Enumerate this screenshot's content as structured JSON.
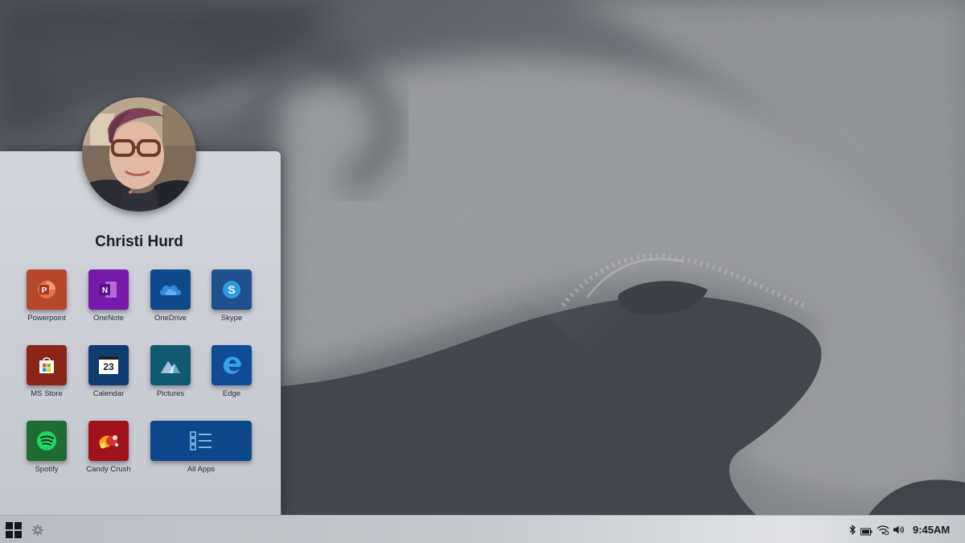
{
  "user": {
    "name": "Christi Hurd"
  },
  "tiles": [
    {
      "label": "Powerpoint",
      "icon": "powerpoint-icon",
      "color": "#b7472a"
    },
    {
      "label": "OneNote",
      "icon": "onenote-icon",
      "color": "#7719aa"
    },
    {
      "label": "OneDrive",
      "icon": "onedrive-icon",
      "color": "#0e4a8a"
    },
    {
      "label": "Skype",
      "icon": "skype-icon",
      "color": "#1f4f8d"
    },
    {
      "label": "MS Store",
      "icon": "store-icon",
      "color": "#8a2518"
    },
    {
      "label": "Calendar",
      "icon": "calendar-icon",
      "color": "#0f3c70",
      "badge": "23"
    },
    {
      "label": "Pictures",
      "icon": "pictures-icon",
      "color": "#125a74"
    },
    {
      "label": "Edge",
      "icon": "edge-icon",
      "color": "#0f4c95"
    },
    {
      "label": "Spotify",
      "icon": "spotify-icon",
      "color": "#1e6b34"
    },
    {
      "label": "Candy Crush",
      "icon": "candy-crush-icon",
      "color": "#a0131a"
    },
    {
      "label": "All Apps",
      "icon": "all-apps-icon",
      "color": "#0c4889"
    }
  ],
  "taskbar": {
    "time": "9:45AM",
    "tray_icons": [
      "bluetooth-icon",
      "battery-icon",
      "network-icon",
      "volume-icon"
    ]
  }
}
